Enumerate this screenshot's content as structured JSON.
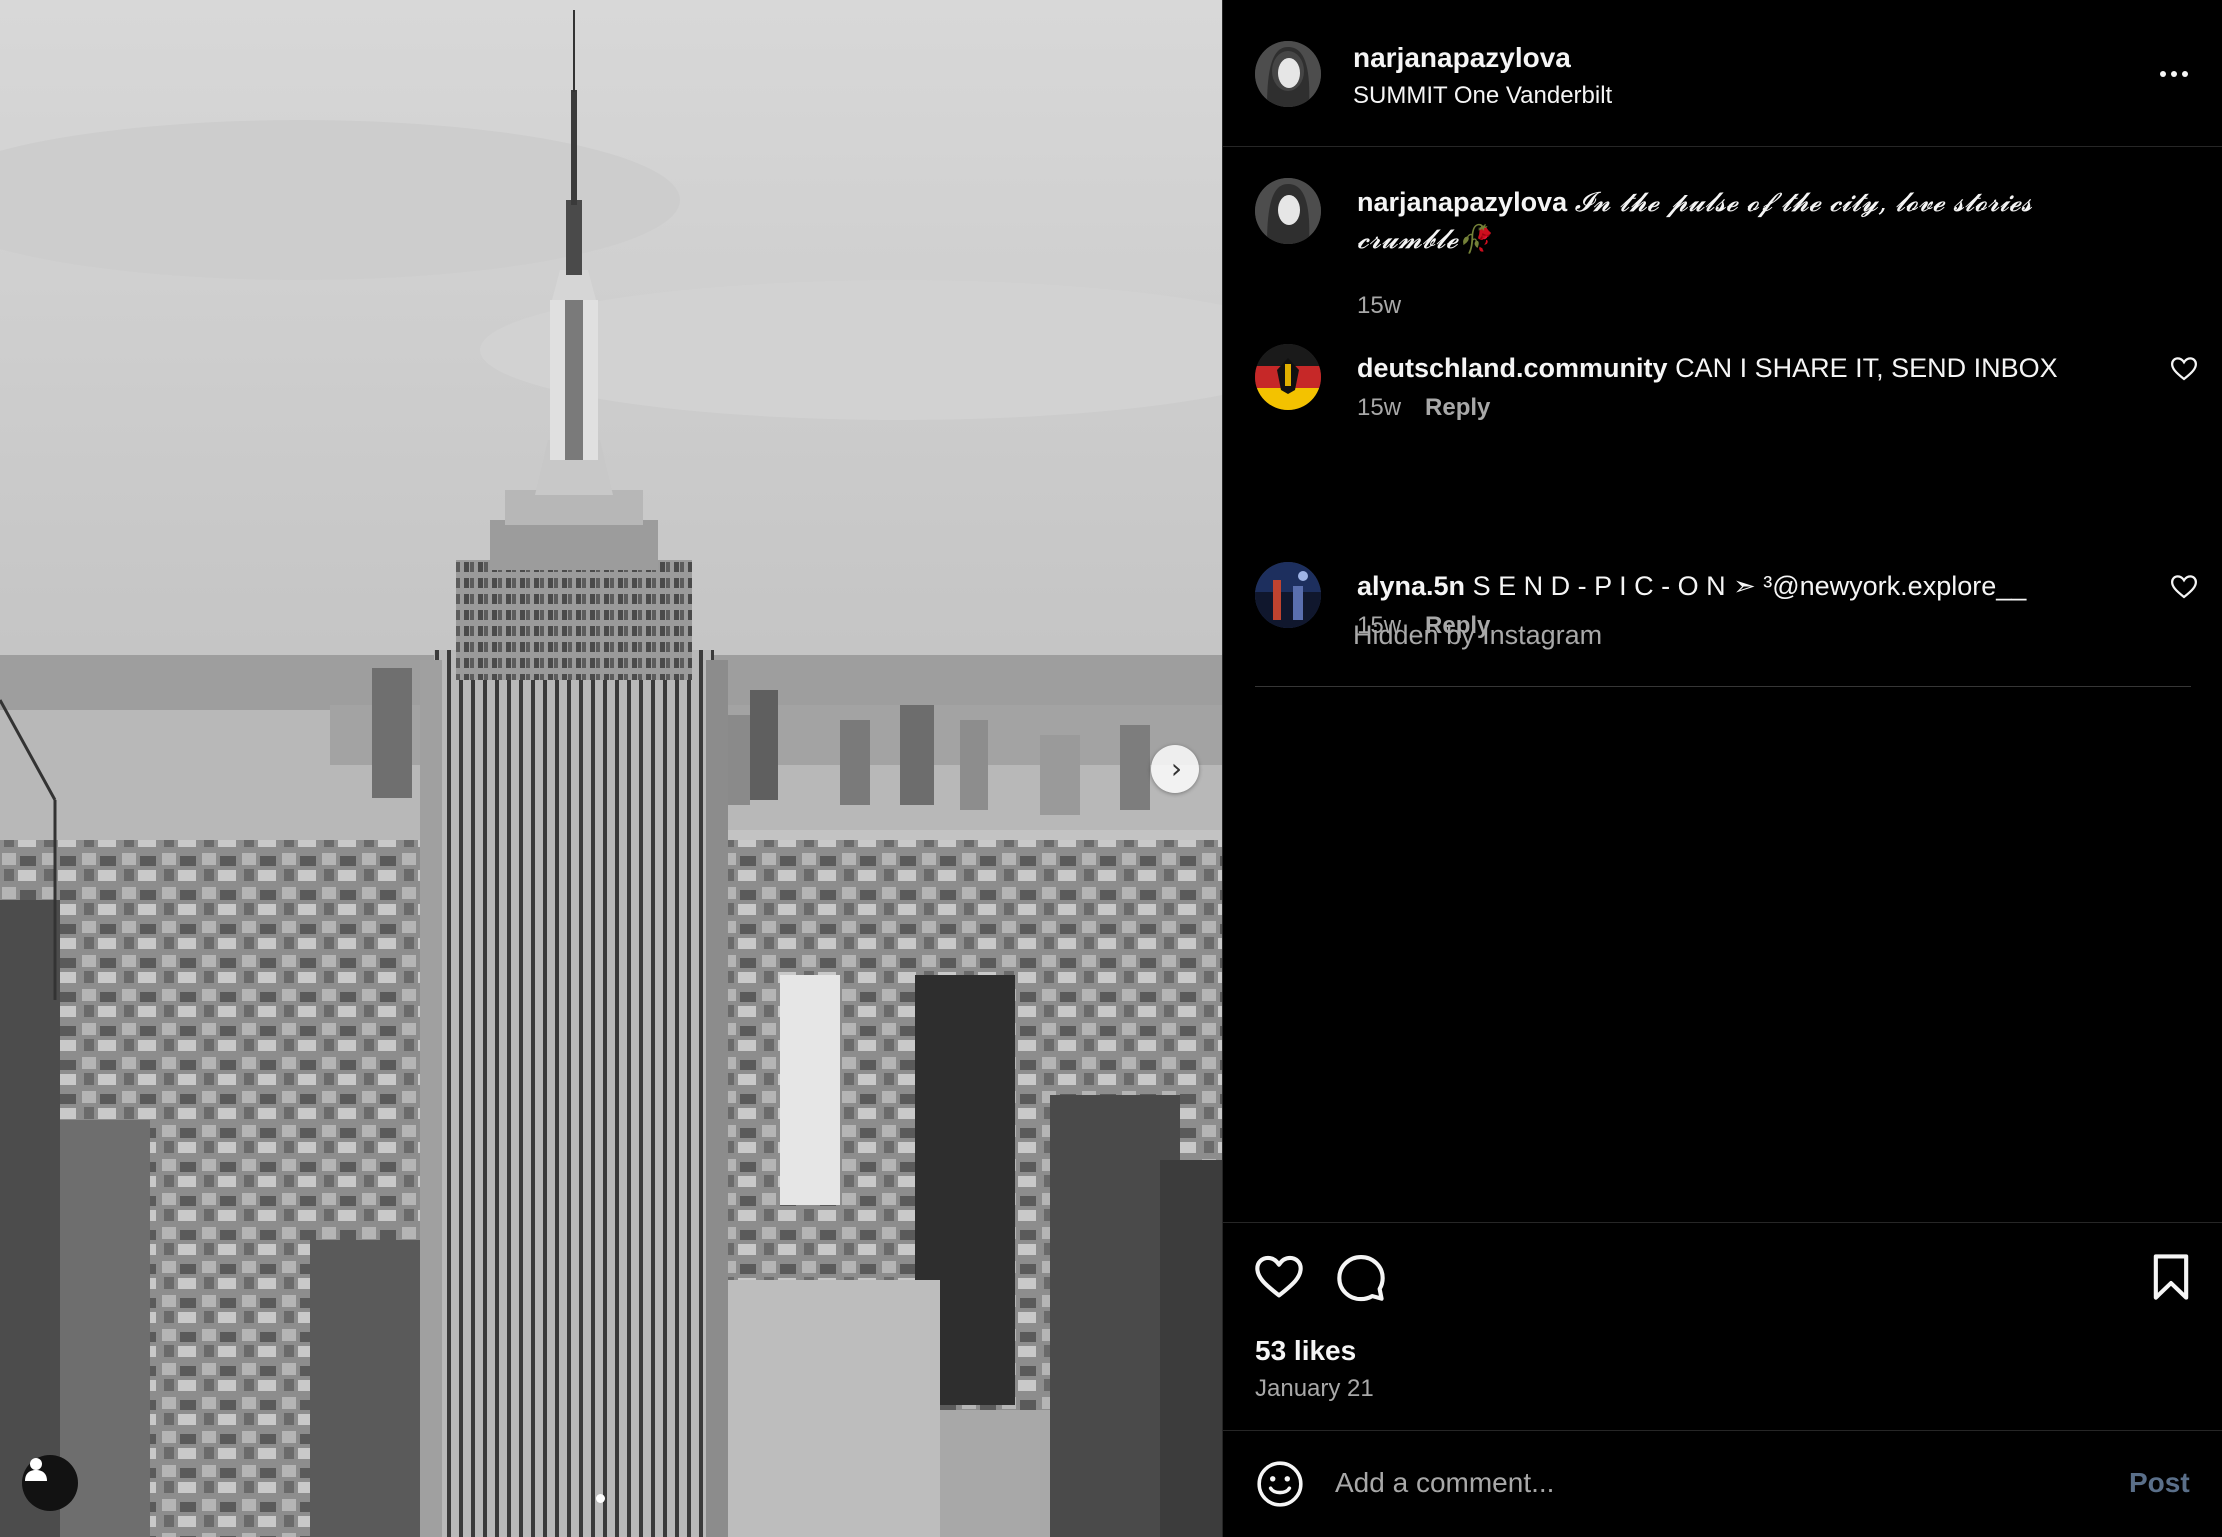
{
  "post": {
    "author": "narjanapazylova",
    "location": "SUMMIT One Vanderbilt",
    "more_icon": "more-horizontal-icon",
    "caption_author": "narjanapazylova",
    "caption_text": "𝓘𝓷 𝓽𝓱𝓮 𝓹𝓾𝓵𝓼𝓮 𝓸𝓯 𝓽𝓱𝓮 𝓬𝓲𝓽𝔂, 𝓵𝓸𝓿𝓮 𝓼𝓽𝓸𝓻𝓲𝓮𝓼 𝓬𝓻𝓾𝓶𝓫𝓵𝓮🥀",
    "caption_time": "15w",
    "likes": "53 likes",
    "date": "January 21",
    "photo_description_icon": "tagged-user-icon",
    "carousel_dots": 2
  },
  "comments": [
    {
      "user": "deutschland.community",
      "text": "CAN I SHARE IT, SEND INBOX",
      "time": "15w",
      "reply_label": "Reply"
    },
    {
      "user": "alyna.5n",
      "text": "S E N D - P I C - O N ➣ ³@newyork.explore__",
      "time": "15w",
      "reply_label": "Reply"
    }
  ],
  "hidden_label": "Hidden by Instagram",
  "composer": {
    "placeholder": "Add a comment...",
    "post_label": "Post"
  },
  "colors": {
    "background": "#000000",
    "text": "#f5f5f5",
    "secondary_text": "#a8a8a8",
    "post_button_disabled": "#5a6f89"
  }
}
